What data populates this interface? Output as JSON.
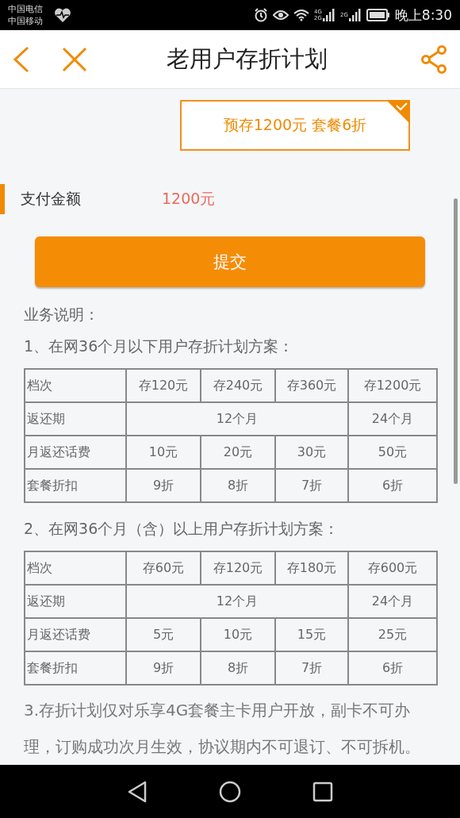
{
  "status_bar": {
    "carriers": [
      "中国电信",
      "中国移动"
    ],
    "network_labels": [
      [
        "4G",
        "2G"
      ],
      [
        "2G"
      ]
    ],
    "time": "晚上8:30"
  },
  "header": {
    "title": "老用户存折计划"
  },
  "plans": [
    {
      "label": "预存1200元 套餐6折",
      "selected": true
    }
  ],
  "payment": {
    "label": "支付金额",
    "amount": "1200元"
  },
  "submit": "提交",
  "notes_title": "业务说明：",
  "sections": [
    {
      "heading": "1、在网36个月以下用户存折计划方案：",
      "table": {
        "rows": [
          [
            "档次",
            "存120元",
            "存240元",
            "存360元",
            "存1200元"
          ],
          [
            "返还期",
            {
              "text": "12个月",
              "colspan": 3
            },
            "24个月"
          ],
          [
            "月返还话费",
            "10元",
            "20元",
            "30元",
            "50元"
          ],
          [
            "套餐折扣",
            "9折",
            "8折",
            "7折",
            "6折"
          ]
        ]
      }
    },
    {
      "heading": "2、在网36个月（含）以上用户存折计划方案：",
      "table": {
        "rows": [
          [
            "档次",
            "存60元",
            "存120元",
            "存180元",
            "存600元"
          ],
          [
            "返还期",
            {
              "text": "12个月",
              "colspan": 3
            },
            "24个月"
          ],
          [
            "月返还话费",
            "5元",
            "10元",
            "15元",
            "25元"
          ],
          [
            "套餐折扣",
            "9折",
            "8折",
            "7折",
            "6折"
          ]
        ]
      }
    }
  ],
  "note_3": "3.存折计划仅对乐享4G套餐主卡用户开放，副卡不可办理，订购成功次月生效，协议期内不可退订、不可拆机。"
}
